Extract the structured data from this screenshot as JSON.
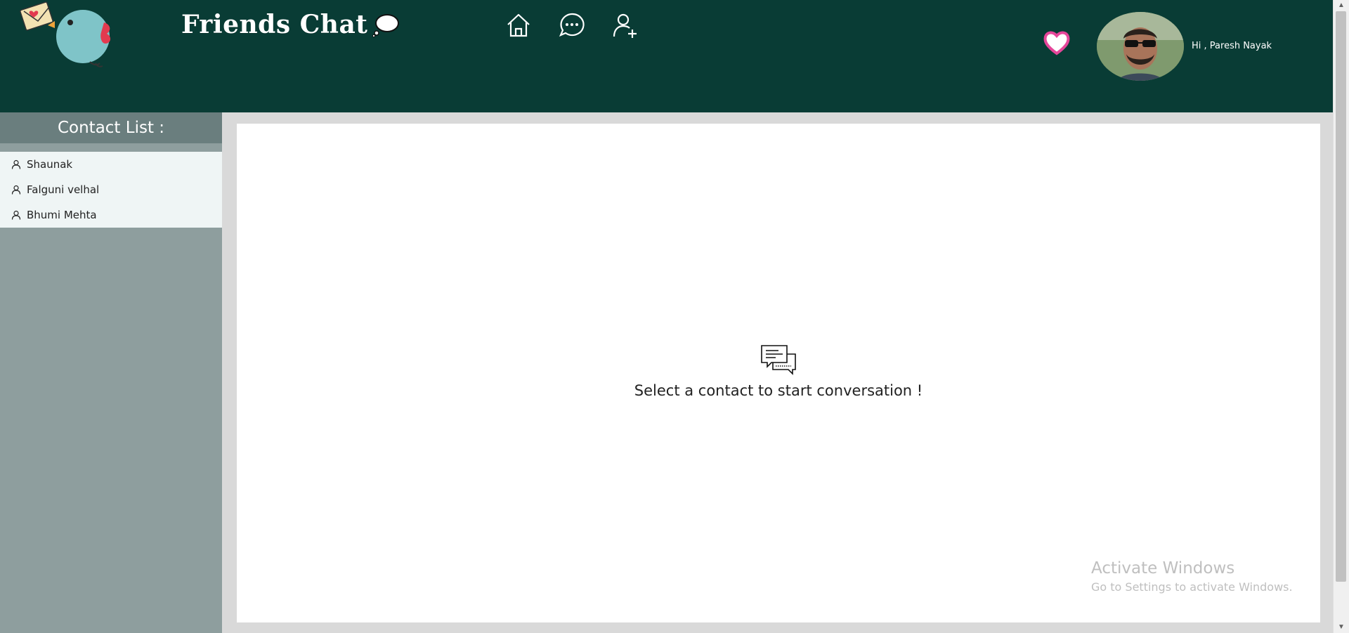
{
  "header": {
    "brand": "Friends Chat",
    "greeting": "Hi , Paresh Nayak"
  },
  "nav": {
    "items": [
      {
        "icon": "home-icon"
      },
      {
        "icon": "chat-icon"
      },
      {
        "icon": "add-user-icon"
      }
    ]
  },
  "sidebar": {
    "title": "Contact List :",
    "contacts": [
      {
        "name": "Shaunak"
      },
      {
        "name": "Falguni velhal"
      },
      {
        "name": "Bhumi Mehta"
      }
    ]
  },
  "main": {
    "empty_message": "Select a contact to start conversation !"
  },
  "watermark": {
    "title": "Activate Windows",
    "subtitle": "Go to Settings to activate Windows."
  },
  "colors": {
    "header_bg": "#093c35",
    "sidebar_bg": "#8e9e9e",
    "sidebar_header_bg": "#6a7e7e",
    "contact_list_bg": "#eff5f5",
    "heart": "#e6469a"
  }
}
